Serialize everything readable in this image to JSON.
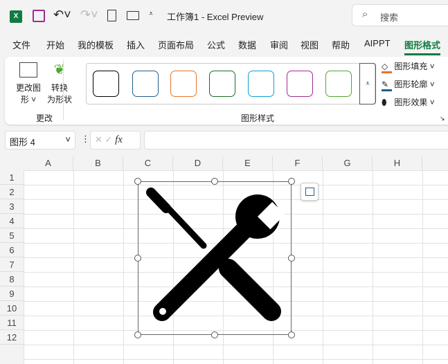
{
  "titlebar": {
    "title": "工作簿1  -  Excel Preview",
    "search_placeholder": "搜索"
  },
  "menu": [
    "文件",
    "开始",
    "我的模板",
    "插入",
    "页面布局",
    "公式",
    "数据",
    "审阅",
    "视图",
    "帮助",
    "AIPPT",
    "图形格式"
  ],
  "ribbon": {
    "change_shape": "更改图",
    "change_shape2": "形",
    "convert": "转换",
    "convert2": "为形状",
    "group_change": "更改",
    "group_styles": "图形样式",
    "fill": "图形填充",
    "outline": "图形轮廓",
    "effects": "图形效果",
    "style_colors": [
      "#000000",
      "#1e5f8c",
      "#e97132",
      "#196b24",
      "#0f9ed5",
      "#a02b93",
      "#4ea72e"
    ],
    "fill_color": "#e97132",
    "outline_color": "#1e5f8c"
  },
  "formula_bar": {
    "name_box": "图形 4",
    "fx": "fx",
    "value": ""
  },
  "columns": [
    "A",
    "B",
    "C",
    "D",
    "E",
    "F",
    "G",
    "H"
  ],
  "rows": [
    "1",
    "2",
    "3",
    "4",
    "5",
    "6",
    "7",
    "8",
    "9",
    "10",
    "11",
    "12"
  ]
}
